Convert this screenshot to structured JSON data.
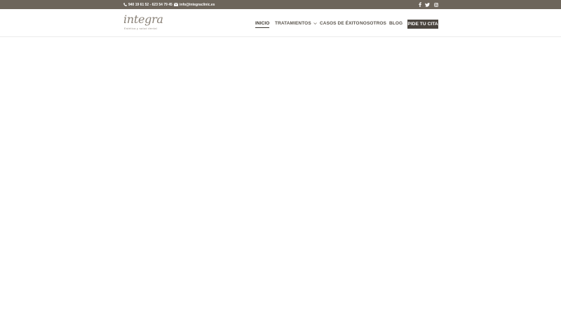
{
  "topbar": {
    "phone": "940 19 61 52 - 623 54 79 45",
    "email": "info@integraclinic.es",
    "social": [
      "facebook-icon",
      "twitter-icon",
      "instagram-icon"
    ],
    "background": "#6d655b"
  },
  "logo": {
    "wordmark": "integra",
    "tagline": "Estética y salud dental"
  },
  "nav": {
    "items": [
      {
        "label": "INICIO",
        "active": true
      },
      {
        "label": "TRATAMIENTOS",
        "has_dropdown": true
      },
      {
        "label": "CASOS DE ÉXITO"
      },
      {
        "label": "NOSOTROS"
      },
      {
        "label": "BLOG"
      }
    ],
    "cta_label": "PIDE TU CITA",
    "cta_color": "#4b453f"
  }
}
